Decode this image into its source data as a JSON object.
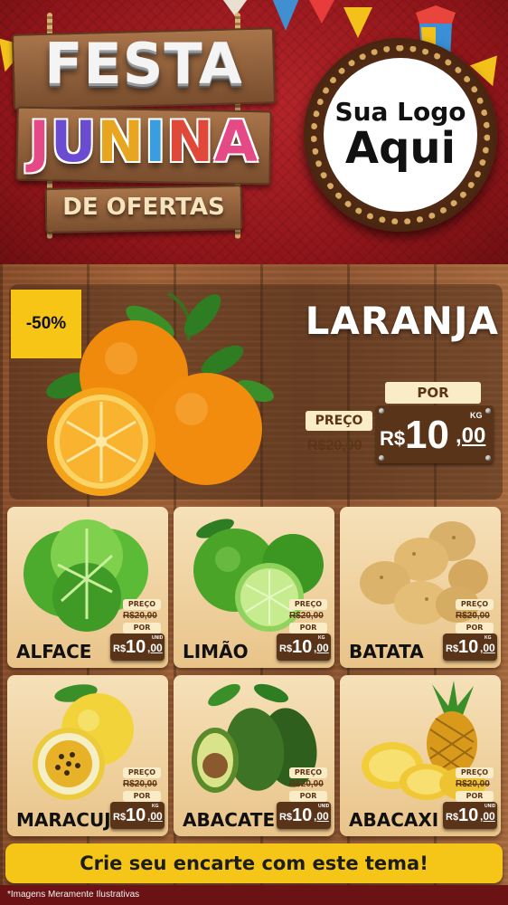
{
  "header": {
    "title_line1": "FESTA",
    "title_line2_letters": [
      "J",
      "U",
      "N",
      "I",
      "N",
      "A"
    ],
    "subtitle": "DE OFERTAS",
    "logo_line1": "Sua Logo",
    "logo_line2": "Aqui"
  },
  "featured": {
    "discount": "-50%",
    "name": "LARANJA",
    "preco_label": "PREÇO",
    "old_price": "R$20,00",
    "por_label": "POR",
    "currency": "R$",
    "price_int": "10",
    "price_dec": ",00",
    "unit": "KG"
  },
  "products": [
    {
      "name": "ALFACE",
      "preco_label": "PREÇO",
      "old_price": "R$20,00",
      "por_label": "POR",
      "currency": "R$",
      "price_int": "10",
      "price_dec": ",00",
      "unit": "UNID"
    },
    {
      "name": "LIMÃO",
      "preco_label": "PREÇO",
      "old_price": "R$20,00",
      "por_label": "POR",
      "currency": "R$",
      "price_int": "10",
      "price_dec": ",00",
      "unit": "KG"
    },
    {
      "name": "BATATA",
      "preco_label": "PREÇO",
      "old_price": "R$20,00",
      "por_label": "POR",
      "currency": "R$",
      "price_int": "10",
      "price_dec": ",00",
      "unit": "KG"
    },
    {
      "name": "MARACUJÁ",
      "preco_label": "PREÇO",
      "old_price": "R$20,00",
      "por_label": "POR",
      "currency": "R$",
      "price_int": "10",
      "price_dec": ",00",
      "unit": "KG"
    },
    {
      "name": "ABACATE",
      "preco_label": "PREÇO",
      "old_price": "R$20,00",
      "por_label": "POR",
      "currency": "R$",
      "price_int": "10",
      "price_dec": ",00",
      "unit": "UNID"
    },
    {
      "name": "ABACAXI",
      "preco_label": "PREÇO",
      "old_price": "R$20,00",
      "por_label": "POR",
      "currency": "R$",
      "price_int": "10",
      "price_dec": ",00",
      "unit": "UNID"
    }
  ],
  "banner": {
    "text": "Crie seu encarte com este tema!"
  },
  "footer": {
    "note": "*Imagens Meramente Ilustrativas"
  },
  "colors": {
    "header_red": "#8e1519",
    "wood": "#a26338",
    "accent_yellow": "#f5c517",
    "price_brown": "#5a3418",
    "label_cream": "#fbecc8"
  }
}
